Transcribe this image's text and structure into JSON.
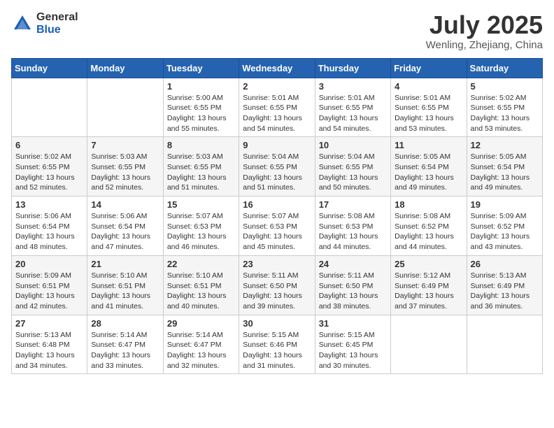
{
  "logo": {
    "general": "General",
    "blue": "Blue"
  },
  "title": "July 2025",
  "location": "Wenling, Zhejiang, China",
  "weekdays": [
    "Sunday",
    "Monday",
    "Tuesday",
    "Wednesday",
    "Thursday",
    "Friday",
    "Saturday"
  ],
  "weeks": [
    [
      {
        "day": "",
        "detail": ""
      },
      {
        "day": "",
        "detail": ""
      },
      {
        "day": "1",
        "detail": "Sunrise: 5:00 AM\nSunset: 6:55 PM\nDaylight: 13 hours and 55 minutes."
      },
      {
        "day": "2",
        "detail": "Sunrise: 5:01 AM\nSunset: 6:55 PM\nDaylight: 13 hours and 54 minutes."
      },
      {
        "day": "3",
        "detail": "Sunrise: 5:01 AM\nSunset: 6:55 PM\nDaylight: 13 hours and 54 minutes."
      },
      {
        "day": "4",
        "detail": "Sunrise: 5:01 AM\nSunset: 6:55 PM\nDaylight: 13 hours and 53 minutes."
      },
      {
        "day": "5",
        "detail": "Sunrise: 5:02 AM\nSunset: 6:55 PM\nDaylight: 13 hours and 53 minutes."
      }
    ],
    [
      {
        "day": "6",
        "detail": "Sunrise: 5:02 AM\nSunset: 6:55 PM\nDaylight: 13 hours and 52 minutes."
      },
      {
        "day": "7",
        "detail": "Sunrise: 5:03 AM\nSunset: 6:55 PM\nDaylight: 13 hours and 52 minutes."
      },
      {
        "day": "8",
        "detail": "Sunrise: 5:03 AM\nSunset: 6:55 PM\nDaylight: 13 hours and 51 minutes."
      },
      {
        "day": "9",
        "detail": "Sunrise: 5:04 AM\nSunset: 6:55 PM\nDaylight: 13 hours and 51 minutes."
      },
      {
        "day": "10",
        "detail": "Sunrise: 5:04 AM\nSunset: 6:55 PM\nDaylight: 13 hours and 50 minutes."
      },
      {
        "day": "11",
        "detail": "Sunrise: 5:05 AM\nSunset: 6:54 PM\nDaylight: 13 hours and 49 minutes."
      },
      {
        "day": "12",
        "detail": "Sunrise: 5:05 AM\nSunset: 6:54 PM\nDaylight: 13 hours and 49 minutes."
      }
    ],
    [
      {
        "day": "13",
        "detail": "Sunrise: 5:06 AM\nSunset: 6:54 PM\nDaylight: 13 hours and 48 minutes."
      },
      {
        "day": "14",
        "detail": "Sunrise: 5:06 AM\nSunset: 6:54 PM\nDaylight: 13 hours and 47 minutes."
      },
      {
        "day": "15",
        "detail": "Sunrise: 5:07 AM\nSunset: 6:53 PM\nDaylight: 13 hours and 46 minutes."
      },
      {
        "day": "16",
        "detail": "Sunrise: 5:07 AM\nSunset: 6:53 PM\nDaylight: 13 hours and 45 minutes."
      },
      {
        "day": "17",
        "detail": "Sunrise: 5:08 AM\nSunset: 6:53 PM\nDaylight: 13 hours and 44 minutes."
      },
      {
        "day": "18",
        "detail": "Sunrise: 5:08 AM\nSunset: 6:52 PM\nDaylight: 13 hours and 44 minutes."
      },
      {
        "day": "19",
        "detail": "Sunrise: 5:09 AM\nSunset: 6:52 PM\nDaylight: 13 hours and 43 minutes."
      }
    ],
    [
      {
        "day": "20",
        "detail": "Sunrise: 5:09 AM\nSunset: 6:51 PM\nDaylight: 13 hours and 42 minutes."
      },
      {
        "day": "21",
        "detail": "Sunrise: 5:10 AM\nSunset: 6:51 PM\nDaylight: 13 hours and 41 minutes."
      },
      {
        "day": "22",
        "detail": "Sunrise: 5:10 AM\nSunset: 6:51 PM\nDaylight: 13 hours and 40 minutes."
      },
      {
        "day": "23",
        "detail": "Sunrise: 5:11 AM\nSunset: 6:50 PM\nDaylight: 13 hours and 39 minutes."
      },
      {
        "day": "24",
        "detail": "Sunrise: 5:11 AM\nSunset: 6:50 PM\nDaylight: 13 hours and 38 minutes."
      },
      {
        "day": "25",
        "detail": "Sunrise: 5:12 AM\nSunset: 6:49 PM\nDaylight: 13 hours and 37 minutes."
      },
      {
        "day": "26",
        "detail": "Sunrise: 5:13 AM\nSunset: 6:49 PM\nDaylight: 13 hours and 36 minutes."
      }
    ],
    [
      {
        "day": "27",
        "detail": "Sunrise: 5:13 AM\nSunset: 6:48 PM\nDaylight: 13 hours and 34 minutes."
      },
      {
        "day": "28",
        "detail": "Sunrise: 5:14 AM\nSunset: 6:47 PM\nDaylight: 13 hours and 33 minutes."
      },
      {
        "day": "29",
        "detail": "Sunrise: 5:14 AM\nSunset: 6:47 PM\nDaylight: 13 hours and 32 minutes."
      },
      {
        "day": "30",
        "detail": "Sunrise: 5:15 AM\nSunset: 6:46 PM\nDaylight: 13 hours and 31 minutes."
      },
      {
        "day": "31",
        "detail": "Sunrise: 5:15 AM\nSunset: 6:45 PM\nDaylight: 13 hours and 30 minutes."
      },
      {
        "day": "",
        "detail": ""
      },
      {
        "day": "",
        "detail": ""
      }
    ]
  ]
}
